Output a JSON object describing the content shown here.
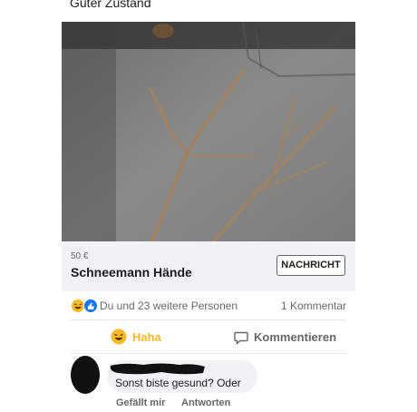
{
  "post": {
    "condition_text": "Guter Zustand"
  },
  "listing": {
    "price": "50 €",
    "title": "Schneemann Hände",
    "message_button": "NACHRICHT"
  },
  "reactions": {
    "summary": "Du und 23 weitere Personen",
    "comment_count": "1 Kommentar",
    "icons": [
      "haha-emoji-icon",
      "like-thumb-icon"
    ]
  },
  "actions": {
    "haha_label": "Haha",
    "comment_label": "Kommentieren"
  },
  "comment": {
    "text": "Sonst biste gesund? Oder",
    "like_label": "Gefällt mir",
    "reply_label": "Antworten"
  },
  "colors": {
    "haha_yellow": "#f7b928",
    "like_blue": "#1877f2",
    "muted_text": "#65676b",
    "bubble_bg": "#f0f2f5"
  }
}
